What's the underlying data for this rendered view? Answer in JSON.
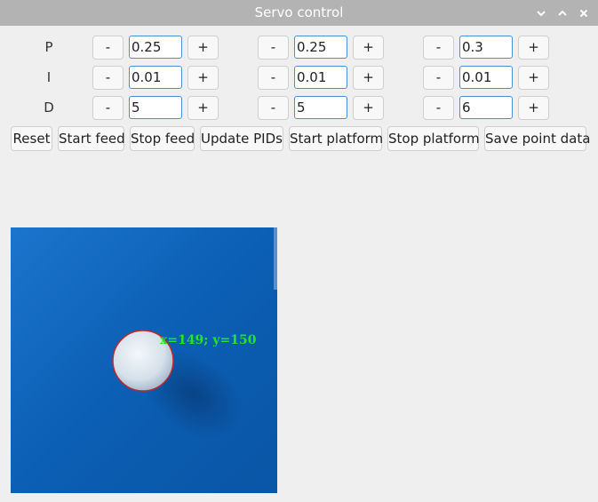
{
  "window": {
    "title": "Servo control",
    "controls": [
      {
        "name": "minimize-icon",
        "icon": "chevron-down"
      },
      {
        "name": "maximize-icon",
        "icon": "chevron-up"
      },
      {
        "name": "close-icon",
        "icon": "close-x"
      }
    ]
  },
  "pid": {
    "rows": [
      {
        "label": "P",
        "values": [
          "0.25",
          "0.25",
          "0.3"
        ]
      },
      {
        "label": "I",
        "values": [
          "0.01",
          "0.01",
          "0.01"
        ]
      },
      {
        "label": "D",
        "values": [
          "5",
          "5",
          "6"
        ]
      }
    ],
    "minus_label": "-",
    "plus_label": "+"
  },
  "actions": {
    "reset": "Reset",
    "start_feed": "Start feed",
    "stop_feed": "Stop feed",
    "update_pids": "Update PIDs",
    "start_platform": "Start platform",
    "stop_platform": "Stop platform",
    "save_point_data": "Save point data"
  },
  "camera": {
    "overlay_text": "x=149; y=150",
    "colors": {
      "background": "#0b5fb4",
      "ball": "#dfe7ee",
      "ball_outline": "#c0282a",
      "overlay": "#22e622"
    }
  },
  "colors": {
    "titlebar": "#b3b3b3",
    "window": "#efefef",
    "field_border": "#4a90d9"
  }
}
